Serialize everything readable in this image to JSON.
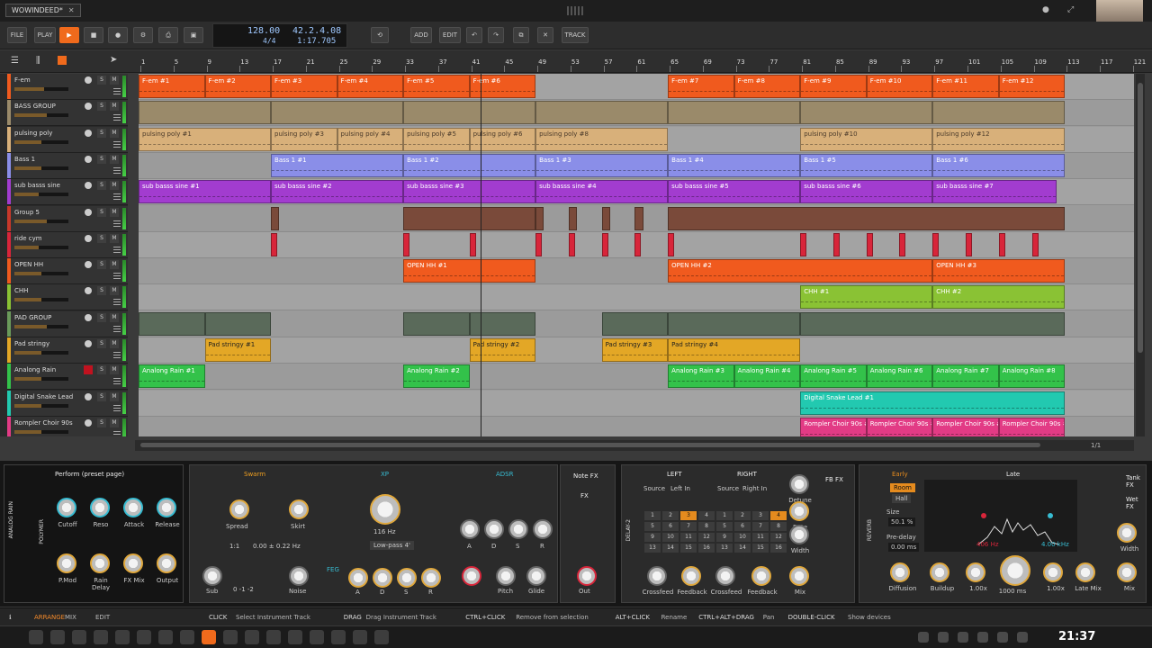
{
  "window": {
    "project_tab": "WOWINDEED*",
    "close": "✕"
  },
  "toolbar": {
    "file": "FILE",
    "play_mode": "PLAY",
    "add": "ADD",
    "edit": "EDIT",
    "track": "TRACK",
    "tempo": "128.00",
    "time_sig": "4/4",
    "position_beats": "42.2.4.08",
    "position_time": "1:17.705"
  },
  "ruler": {
    "bars": [
      "1",
      "5",
      "9",
      "13",
      "17",
      "21",
      "25",
      "29",
      "33",
      "37",
      "41",
      "45",
      "49",
      "53",
      "57",
      "61",
      "65",
      "69",
      "73",
      "77",
      "81",
      "85",
      "89",
      "93",
      "97",
      "101",
      "105",
      "109",
      "113",
      "117",
      "121"
    ]
  },
  "tracks": [
    {
      "name": "F-em",
      "color": "#f05a1e",
      "fader": 0.55
    },
    {
      "name": "BASS GROUP",
      "color": "#9a8a6a",
      "fader": 0.6,
      "group": true
    },
    {
      "name": "pulsing poly",
      "color": "#d8b07a",
      "fader": 0.5
    },
    {
      "name": "Bass 1",
      "color": "#8a8ee8",
      "fader": 0.5
    },
    {
      "name": "sub basss sine",
      "color": "#a23ccf",
      "fader": 0.45
    },
    {
      "name": "Group 5",
      "color": "#c8382a",
      "fader": 0.6,
      "group": true
    },
    {
      "name": "ride cym",
      "color": "#d8253a",
      "fader": 0.45
    },
    {
      "name": "OPEN HH",
      "color": "#f05a1e",
      "fader": 0.5
    },
    {
      "name": "CHH",
      "color": "#8ac234",
      "fader": 0.5
    },
    {
      "name": "PAD GROUP",
      "color": "#6a9a5a",
      "fader": 0.6,
      "group": true
    },
    {
      "name": "Pad stringy",
      "color": "#e3a726",
      "fader": 0.5
    },
    {
      "name": "Analong Rain",
      "color": "#33c24a",
      "fader": 0.5,
      "armed": true
    },
    {
      "name": "Digital Snake Lead",
      "color": "#22c9b0",
      "fader": 0.5
    },
    {
      "name": "Rompler Choir 90s",
      "color": "#e23b85",
      "fader": 0.5
    }
  ],
  "clips": {
    "fem": [
      "F-em #1",
      "F-em #2",
      "F-em #3",
      "F-em #4",
      "F-em #5",
      "F-em #6",
      "F-em #7",
      "F-em #8",
      "F-em #9",
      "F-em #10",
      "F-em #11",
      "F-em #12"
    ],
    "pulsing": [
      "pulsing poly #1",
      "pulsing poly #3",
      "pulsing poly #4",
      "pulsing poly #5",
      "pulsing poly #6",
      "pulsing poly #8",
      "pulsing poly #10",
      "pulsing poly #12"
    ],
    "bass": [
      "Bass 1 #1",
      "Bass 1 #2",
      "Bass 1 #3",
      "Bass 1 #4",
      "Bass 1 #5",
      "Bass 1 #6"
    ],
    "sub": [
      "sub basss sine #1",
      "sub basss sine #2",
      "sub basss sine #3",
      "sub basss sine #4",
      "sub basss sine #5",
      "sub basss sine #6",
      "sub basss sine #7"
    ],
    "openhh": [
      "OPEN HH #1",
      "OPEN HH #2",
      "OPEN HH #3"
    ],
    "chh": [
      "CHH #1",
      "CHH #2"
    ],
    "pad": [
      "Pad stringy #1",
      "Pad stringy #2",
      "Pad stringy #3",
      "Pad stringy #4"
    ],
    "analog": [
      "Analong Rain #1",
      "Analong Rain #2",
      "Analong Rain #3",
      "Analong Rain #4",
      "Analong Rain #5",
      "Analong Rain #6",
      "Analong Rain #7",
      "Analong Rain #8"
    ],
    "snake": [
      "Digital Snake Lead #1"
    ],
    "choir": [
      "Rompler Choir 90s #",
      "Rompler Choir 90s #",
      "Rompler Choir 90s #",
      "Rompler Choir 90s #"
    ]
  },
  "devices": {
    "poly": {
      "side_label": "ANALOG RAIN",
      "type": "POLYMER",
      "preset": "Perform (preset page)",
      "knobs": [
        "Cutoff",
        "Reso",
        "Attack",
        "Release",
        "P.Mod",
        "Rain Delay",
        "FX Mix",
        "Output"
      ]
    },
    "synth": {
      "swarm": "Swarm",
      "spread": "Spread",
      "skirt": "Skirt",
      "ratio": "1:1",
      "detune_vals": "0.00  ± 0.22 Hz",
      "xp": "XP",
      "freq": "116 Hz",
      "filter": "Low-pass 4'",
      "sub": "Sub",
      "noise": "Noise",
      "adsr": "ADSR",
      "feg": "FEG",
      "env_labels": [
        "A",
        "D",
        "S",
        "R"
      ],
      "pitch": "Pitch",
      "glide": "Glide",
      "out": "Out",
      "note_fx": "Note FX",
      "fx": "FX",
      "osc_vals": "0  -1  -2"
    },
    "delay": {
      "side_label": "DELAY-2",
      "left": "LEFT",
      "right": "RIGHT",
      "src_left": "Left In",
      "src_right": "Right In",
      "source": "Source",
      "grid": [
        "1",
        "2",
        "3",
        "4",
        "5",
        "6",
        "7",
        "8",
        "9",
        "10",
        "11",
        "12",
        "13",
        "14",
        "15",
        "16"
      ],
      "knobs": [
        "Crossfeed",
        "Feedback",
        "Crossfeed",
        "Feedback",
        "Detune",
        "Rate",
        "Width",
        "Mix"
      ],
      "fb_fx": "FB FX"
    },
    "reverb": {
      "side_label": "REVERB",
      "early": "Early",
      "late": "Late",
      "room": "Room",
      "hall": "Hall",
      "size_label": "Size",
      "size": "50.1 %",
      "predelay_label": "Pre-delay",
      "predelay": "0.00 ms",
      "freq_lo": "406 Hz",
      "freq_hi": "4.00 kHz",
      "axis": [
        "-20",
        "-60",
        "100",
        "1k",
        "10k"
      ],
      "knobs": [
        "Diffusion",
        "Buildup",
        "1.00x",
        "1000 ms",
        "1.00x",
        "Late Mix",
        "Width",
        "Mix"
      ],
      "tank_fx": "Tank FX",
      "wet_fx": "Wet FX"
    }
  },
  "status": {
    "tabs": [
      "ARRANGE",
      "MIX",
      "EDIT"
    ],
    "hints": [
      {
        "key": "CLICK",
        "text": "Select Instrument Track"
      },
      {
        "key": "DRAG",
        "text": "Drag Instrument Track"
      },
      {
        "key": "CTRL+CLICK",
        "text": "Remove from selection"
      },
      {
        "key": "ALT+CLICK",
        "text": "Rename"
      },
      {
        "key": "CTRL+ALT+DRAG",
        "text": "Pan"
      },
      {
        "key": "DOUBLE-CLICK",
        "text": "Show devices"
      }
    ],
    "page": "1/1"
  },
  "taskbar": {
    "clock": "21:37"
  }
}
